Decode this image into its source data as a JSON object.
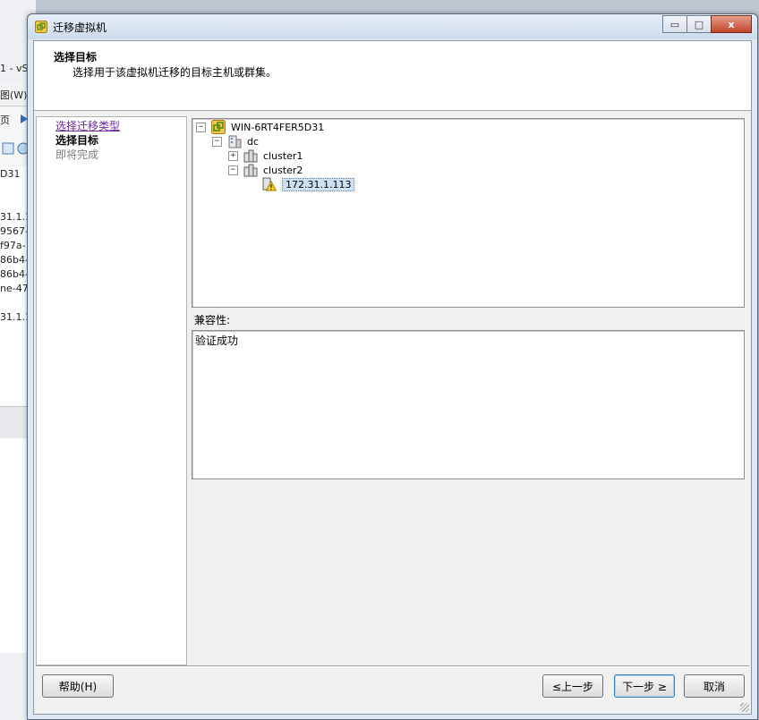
{
  "background_app": {
    "lines": [
      "1 - vS",
      "图(W)",
      "页",
      "D31",
      "31.1.1",
      "9567-",
      "f97a-",
      "86b4-",
      "86b4-",
      "ne-47",
      "31.1.1"
    ]
  },
  "dialog": {
    "title": "迁移虚拟机",
    "window_buttons": {
      "minimize": "▭",
      "maximize": "□",
      "close": "x"
    }
  },
  "header": {
    "title": "选择目标",
    "subtitle": "选择用于该虚拟机迁移的目标主机或群集。"
  },
  "steps": [
    {
      "label": "选择迁移类型",
      "state": "link"
    },
    {
      "label": "选择目标",
      "state": "current"
    },
    {
      "label": "即将完成",
      "state": "pending"
    }
  ],
  "tree": {
    "root": "WIN-6RT4FER5D31",
    "datacenter": "dc",
    "cluster1": "cluster1",
    "cluster2": "cluster2",
    "host": "172.31.1.113"
  },
  "compat": {
    "label": "兼容性:",
    "message": "验证成功"
  },
  "buttons": {
    "help": "帮助(H)",
    "back": "≤上一步",
    "next": "下一步 ≥",
    "cancel": "取消"
  }
}
